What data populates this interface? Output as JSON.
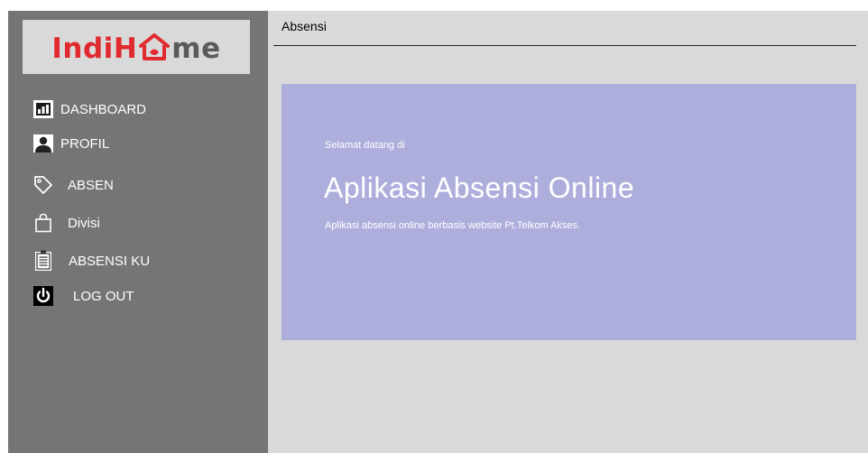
{
  "logo": {
    "part1": "Indi",
    "part2": "me",
    "brand_red": "#e02a2f",
    "brand_gray": "#5a5a5a",
    "icon": "house-icon"
  },
  "sidebar": {
    "items": [
      {
        "label": "DASHBOARD",
        "icon": "bar-chart-icon"
      },
      {
        "label": "PROFIL",
        "icon": "user-icon"
      },
      {
        "label": "ABSEN",
        "icon": "tag-icon"
      },
      {
        "label": "Divisi",
        "icon": "bag-icon"
      },
      {
        "label": "ABSENSI KU",
        "icon": "clipboard-icon"
      },
      {
        "label": "LOG OUT",
        "icon": "power-icon"
      }
    ]
  },
  "header": {
    "title": "Absensi"
  },
  "hero": {
    "welcome": "Selamat datang di",
    "title": "Aplikasi Absensi Online",
    "description": "Aplikasi absensi online berbasis website Pt.Telkom Akses.",
    "background": "#aeaedd"
  }
}
